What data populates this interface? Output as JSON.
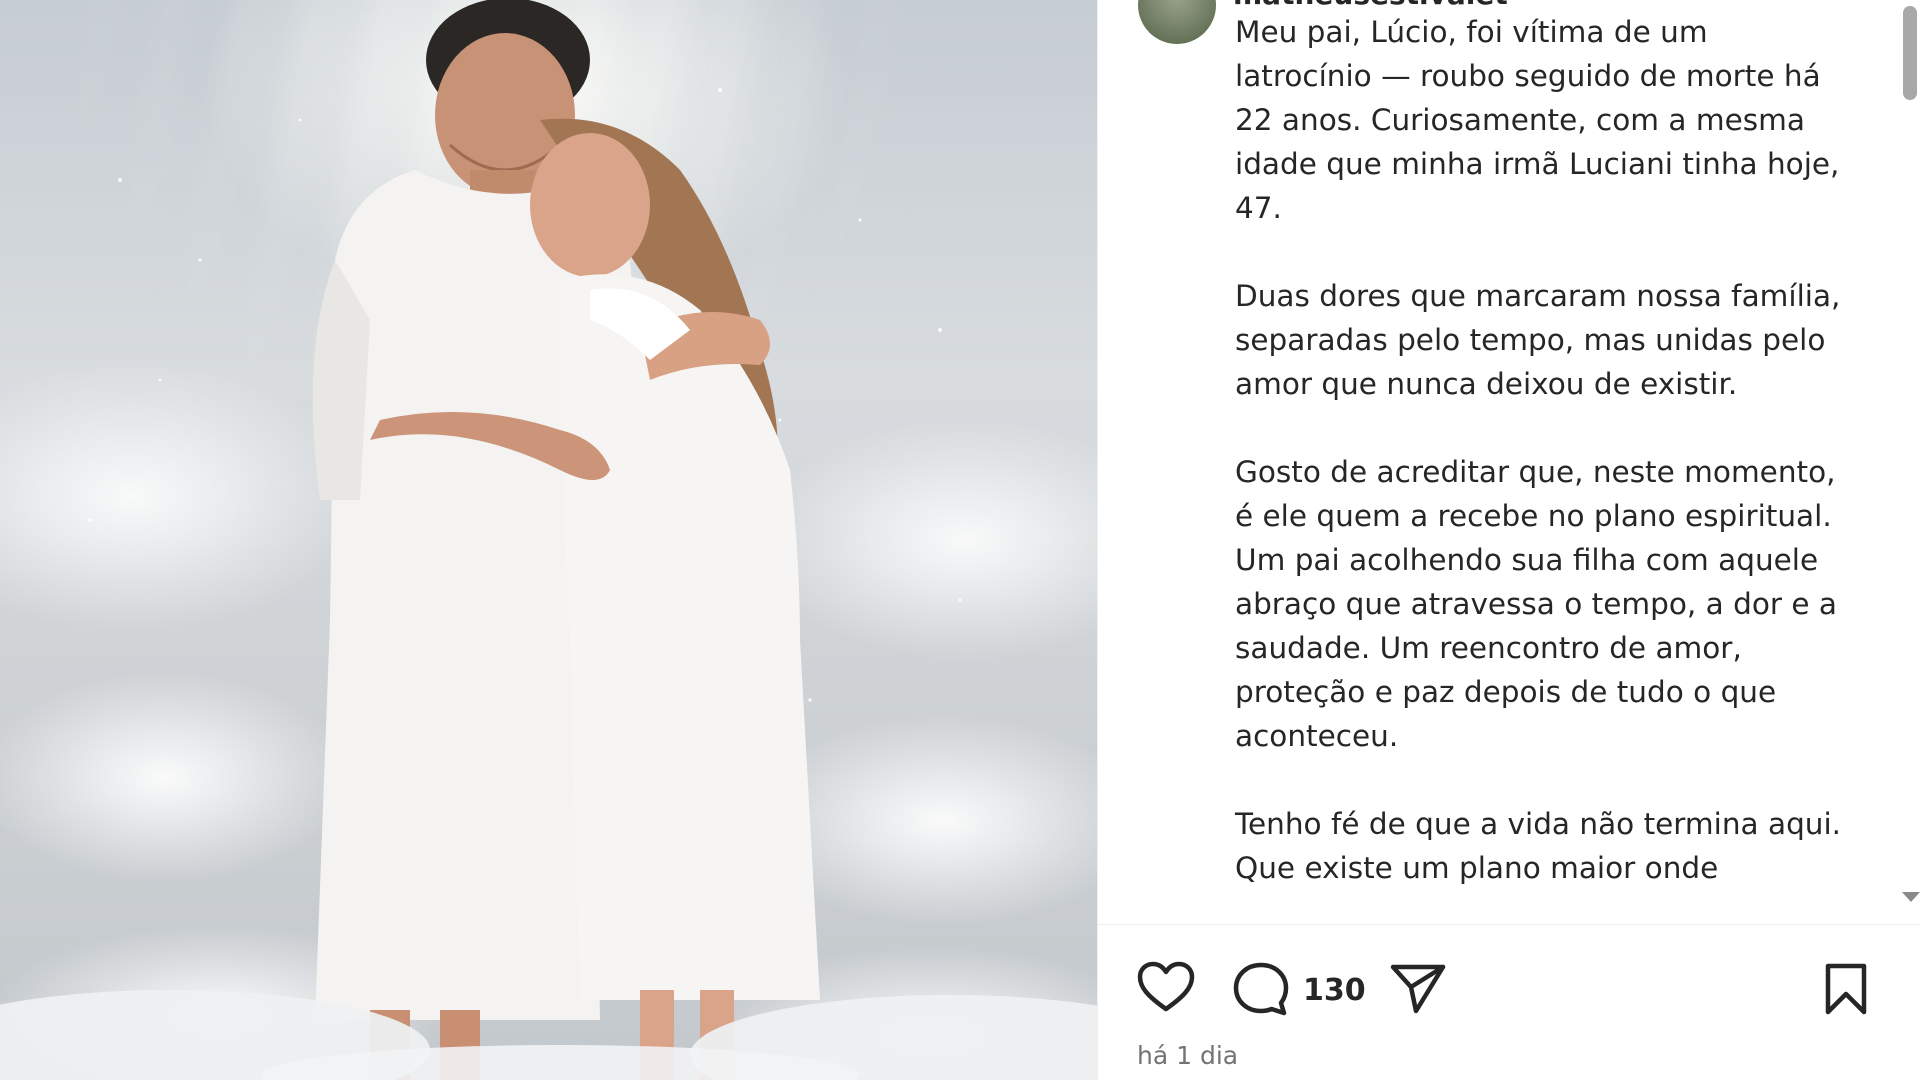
{
  "post": {
    "username": "matheusestivalet",
    "caption": [
      "Meu pai, Lúcio, foi vítima de um latrocínio — roubo seguido de morte há 22 anos. Curiosamente, com a mesma idade que minha irmã Luciani tinha hoje, 47.",
      "Duas dores que marcaram nossa família, separadas pelo tempo, mas unidas pelo amor que nunca deixou de existir.",
      "Gosto de acreditar que, neste momento, é ele quem a recebe no plano espiritual. Um pai acolhendo sua filha com aquele abraço que atravessa o tempo, a dor e a saudade. Um reencontro de amor, proteção e paz depois de tudo o que aconteceu.",
      "Tenho fé de que a vida não termina aqui. Que existe um plano maior onde"
    ],
    "image_icon": "photo-icon"
  },
  "actions": {
    "like_icon": "heart-icon",
    "comment_icon": "comment-icon",
    "comment_count": "130",
    "share_icon": "paper-plane-icon",
    "save_icon": "bookmark-icon"
  },
  "meta": {
    "timestamp": "há 1 dia"
  },
  "colors": {
    "text": "#262626",
    "muted": "#737373",
    "border": "#efefef"
  }
}
